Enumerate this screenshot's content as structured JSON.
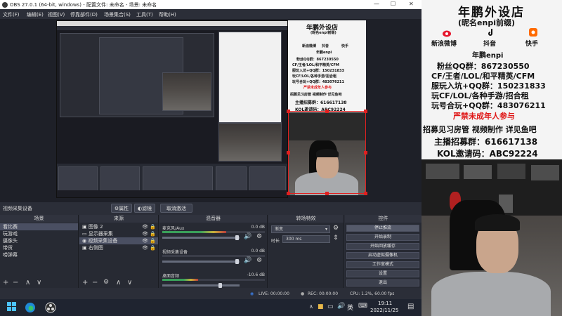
{
  "window": {
    "title": "OBS 27.0.1 (64-bit, windows) - 配置文件: 未命名 - 场景: 未命名",
    "minimize": "—",
    "maximize": "☐",
    "close": "✕"
  },
  "menu": [
    "文件(F)",
    "编辑(E)",
    "视图(V)",
    "停靠部件(D)",
    "场景集合(S)",
    "工具(T)",
    "帮助(H)"
  ],
  "poster": {
    "title": "年鹏外设店",
    "subtitle": "(昵名enpi前缀)",
    "socials": [
      "新浪微博",
      "抖音",
      "快手"
    ],
    "brand": "年鹏enpi",
    "lines": [
      {
        "text": "粉丝QQ群：867230550",
        "color": "#111111"
      },
      {
        "text": "CF/王者/LOL/和平精英/CFM",
        "color": "#111111"
      },
      {
        "text": "服玩入坑+QQ群：150231833",
        "color": "#111111",
        "highlight": "150231833"
      },
      {
        "text": "玩CF/LOL/各种手游/招合租",
        "color": "#111111"
      },
      {
        "text": "玩号合玩+QQ群：483076211",
        "color": "#111111",
        "highlight": "483076211"
      },
      {
        "text": "严禁未成年人参与",
        "color": "#e01818"
      },
      {
        "text": "招募见习房管 视频制作 详见鱼吧",
        "color": "#111111"
      },
      {
        "text": "主播招募群：616617138",
        "color": "#111111"
      },
      {
        "text": "KOL邀请码：ABC92224",
        "color": "#111111"
      }
    ]
  },
  "source_bar": {
    "label": "视频采集设备",
    "properties": "属性",
    "filters": "滤镜",
    "deactivate": "取消激活"
  },
  "docks": {
    "scenes": {
      "title": "场景",
      "items": [
        "看比赛",
        "玩游戏",
        "摄像头",
        "带货",
        "唠弹幕"
      ],
      "selected_index": 0
    },
    "sources": {
      "title": "来源",
      "items": [
        "图像 2",
        "显示器采集",
        "视频采集设备",
        "右侧图"
      ],
      "selected_index": 2
    },
    "mixer": {
      "title": "混音器",
      "channels": [
        {
          "name": "麦克风/Aux",
          "db": "0.0 dB",
          "level": 0.62
        },
        {
          "name": "视频采集设备",
          "db": "0.0 dB",
          "level": 0.0
        },
        {
          "name": "桌面音频",
          "db": "-10.6 dB",
          "level": 0.35
        }
      ]
    },
    "transitions": {
      "title": "转场特效",
      "selected": "渐变",
      "duration_label": "时长",
      "duration_value": "300 ms"
    },
    "controls": {
      "title": "控件",
      "buttons": [
        "停止推流",
        "开始录制",
        "开始回放缓存",
        "启动虚拟摄像机",
        "工作室模式",
        "设置",
        "退出"
      ]
    }
  },
  "status": {
    "live": "LIVE: 00:00:00",
    "rec": "REC: 00:00:00",
    "cpu": "CPU: 1.2%, 60.00 fps"
  },
  "taskbar": {
    "ime": "英",
    "time": "19:11",
    "date": "2022/11/25"
  }
}
